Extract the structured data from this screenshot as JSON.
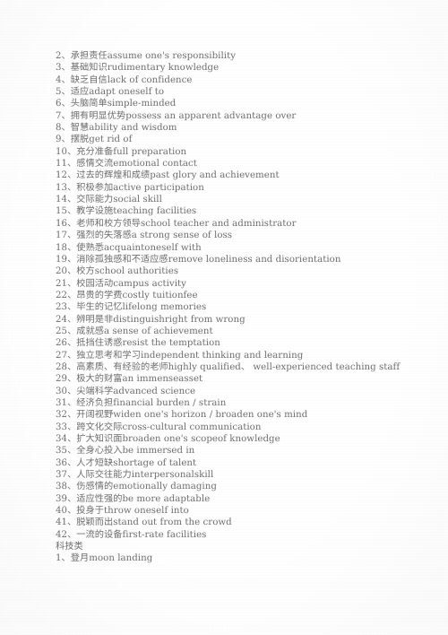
{
  "document": {
    "background_color": "#ffffff",
    "text_color": "#6e6e6e",
    "section_heading": "科技类",
    "lines": [
      "2、承担责任assume one's responsibility",
      "3、基础知识rudimentary knowledge",
      "4、缺乏自信lack of confidence",
      "5、适应adapt oneself to",
      "6、头脑简单simple-minded",
      "7、拥有明显优势possess an apparent advantage over",
      "8、智慧ability and wisdom",
      "9、摆脱get rid of",
      "10、充分准备full preparation",
      "11、感情交流emotional contact",
      "12、过去的辉煌和成绩past glory and achievement",
      "13、积极参加active participation",
      "14、交际能力social skill",
      "15、教学设施teaching facilities",
      "16、老师和校方领导school teacher and administrator",
      "17、强烈的失落感a strong sense of loss",
      "18、使熟悉acquaintoneself with",
      "19、消除孤独感和不适应感remove loneliness and disorientation",
      "20、校方school authorities",
      "21、校园活动campus activity",
      "22、昂贵的学费costly tuitionfee",
      "23、毕生的记忆lifelong memories",
      "24、辨明是非distinguishright from wrong",
      "25、成就感a sense of achievement",
      "26、抵挡住诱惑resist the temptation",
      "27、独立思考和学习independent thinking and learning",
      "28、高素质、有经验的老师highly qualified、 well-experienced teaching staff",
      "29、极大的财富an immenseasset",
      "30、尖端科学advanced science",
      "31、经济负担financial burden / strain",
      "32、开阔视野widen one's horizon / broaden one's mind",
      "33、跨文化交际cross-cultural communication",
      "34、扩大知识面broaden one's scopeof knowledge",
      "35、全身心投入be immersed in",
      "36、人才短缺shortage of talent",
      "37、人际交往能力interpersonalskill",
      "38、伤感情的emotionally damaging",
      "39、适应性强的be more adaptable",
      "40、投身于throw oneself into",
      "41、脱颖而出stand out from the crowd",
      "42、一流的设备first-rate facilities"
    ],
    "after_section_lines": [
      "1、登月moon landing"
    ]
  }
}
